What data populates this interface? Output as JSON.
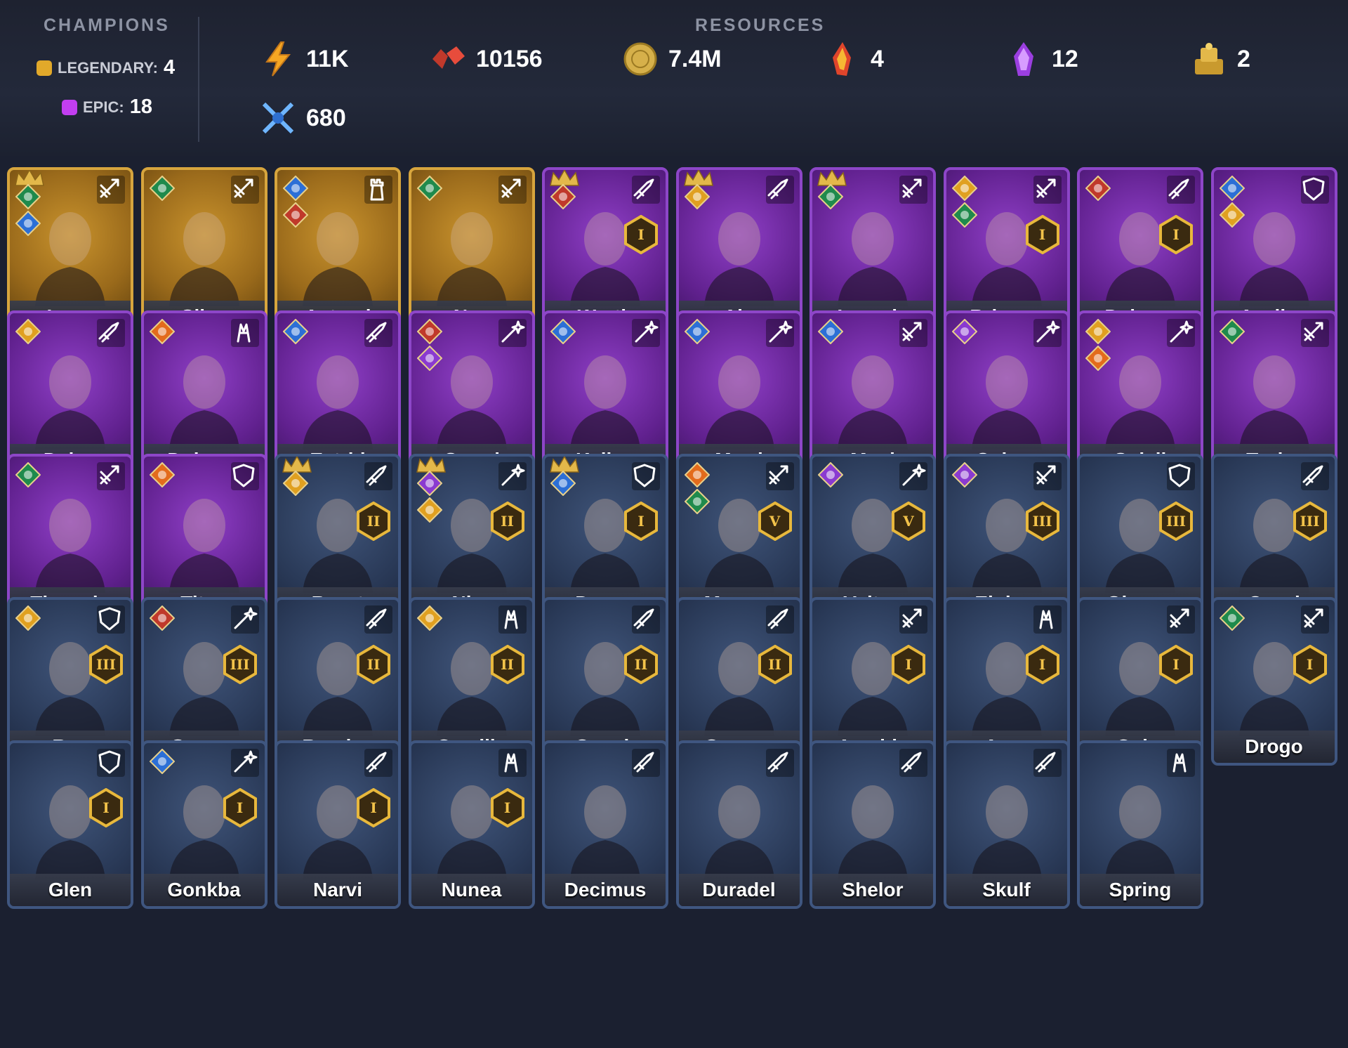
{
  "header": {
    "champions_title": "CHAMPIONS",
    "legendary_label": "LEGENDARY:",
    "legendary_count": "4",
    "epic_label": "EPIC:",
    "epic_count": "18",
    "resources_title": "RESOURCES",
    "resources": [
      {
        "icon": "energy-icon",
        "value": "11K"
      },
      {
        "icon": "rubies-icon",
        "value": "10156"
      },
      {
        "icon": "gold-icon",
        "value": "7.4M"
      },
      {
        "icon": "fire-shard-icon",
        "value": "4"
      },
      {
        "icon": "void-shard-icon",
        "value": "12"
      },
      {
        "icon": "gold-tokens-icon",
        "value": "2"
      },
      {
        "icon": "arena-swords-icon",
        "value": "680"
      }
    ]
  },
  "colors": {
    "legendary": "#d7a53d",
    "epic": "#8d46c8",
    "rare": "#3f5680",
    "rank_gold": "#f2c24a"
  },
  "champions": [
    {
      "name": "Iovar",
      "rarity": "legendary",
      "role": "attack-icon",
      "affinities": [
        "force",
        "magic"
      ],
      "crown": true,
      "rank": ""
    },
    {
      "name": "Silas",
      "rarity": "legendary",
      "role": "attack-icon",
      "affinities": [
        "force"
      ],
      "crown": false,
      "rank": ""
    },
    {
      "name": "Astrael",
      "rarity": "legendary",
      "role": "tower-icon",
      "affinities": [
        "magic",
        "spirit"
      ],
      "crown": false,
      "rank": ""
    },
    {
      "name": "Nyx",
      "rarity": "legendary",
      "role": "attack-icon",
      "affinities": [
        "force"
      ],
      "crown": false,
      "rank": ""
    },
    {
      "name": "Wrath",
      "rarity": "epic",
      "role": "sword-icon",
      "affinities": [
        "spirit"
      ],
      "crown": true,
      "rank": "I"
    },
    {
      "name": "Ain",
      "rarity": "epic",
      "role": "sword-icon",
      "affinities": [
        "void"
      ],
      "crown": true,
      "rank": ""
    },
    {
      "name": "Luneria",
      "rarity": "epic",
      "role": "attack-icon",
      "affinities": [
        "force"
      ],
      "crown": true,
      "rank": ""
    },
    {
      "name": "Brienne",
      "rarity": "epic",
      "role": "attack-icon",
      "affinities": [
        "void",
        "force"
      ],
      "crown": false,
      "rank": "I"
    },
    {
      "name": "Deimos",
      "rarity": "epic",
      "role": "sword-icon",
      "affinities": [
        "spirit"
      ],
      "crown": false,
      "rank": "I"
    },
    {
      "name": "Aveline",
      "rarity": "epic",
      "role": "shield-icon",
      "affinities": [
        "magic",
        "void"
      ],
      "crown": false,
      "rank": ""
    },
    {
      "name": "Dalyn",
      "rarity": "epic",
      "role": "sword-icon",
      "affinities": [
        "void"
      ],
      "crown": false,
      "rank": ""
    },
    {
      "name": "Dolores",
      "rarity": "epic",
      "role": "support-icon",
      "affinities": [
        "fire"
      ],
      "crown": false,
      "rank": ""
    },
    {
      "name": "Estrid",
      "rarity": "epic",
      "role": "sword-icon",
      "affinities": [
        "magic"
      ],
      "crown": false,
      "rank": ""
    },
    {
      "name": "Greed",
      "rarity": "epic",
      "role": "wand-icon",
      "affinities": [
        "spirit",
        "swirl"
      ],
      "crown": false,
      "rank": ""
    },
    {
      "name": "Kalina",
      "rarity": "epic",
      "role": "wand-icon",
      "affinities": [
        "magic"
      ],
      "crown": false,
      "rank": ""
    },
    {
      "name": "Marri",
      "rarity": "epic",
      "role": "wand-icon",
      "affinities": [
        "magic"
      ],
      "crown": false,
      "rank": ""
    },
    {
      "name": "Maul",
      "rarity": "epic",
      "role": "attack-icon",
      "affinities": [
        "magic"
      ],
      "crown": false,
      "rank": ""
    },
    {
      "name": "Osiren",
      "rarity": "epic",
      "role": "wand-icon",
      "affinities": [
        "swirl"
      ],
      "crown": false,
      "rank": ""
    },
    {
      "name": "Soleil",
      "rarity": "epic",
      "role": "wand-icon",
      "affinities": [
        "void",
        "fire"
      ],
      "crown": false,
      "rank": ""
    },
    {
      "name": "Tazira",
      "rarity": "epic",
      "role": "attack-icon",
      "affinities": [
        "force"
      ],
      "crown": false,
      "rank": ""
    },
    {
      "name": "Theowin",
      "rarity": "epic",
      "role": "attack-icon",
      "affinities": [
        "force"
      ],
      "crown": false,
      "rank": ""
    },
    {
      "name": "Titus",
      "rarity": "epic",
      "role": "shield-icon",
      "affinities": [
        "fire"
      ],
      "crown": false,
      "rank": ""
    },
    {
      "name": "Borut",
      "rarity": "rare",
      "role": "sword-icon",
      "affinities": [
        "void"
      ],
      "crown": true,
      "rank": "II"
    },
    {
      "name": "Niro",
      "rarity": "rare",
      "role": "wand-icon",
      "affinities": [
        "swirl",
        "void"
      ],
      "crown": true,
      "rank": "II"
    },
    {
      "name": "Dagna",
      "rarity": "rare",
      "role": "shield-icon",
      "affinities": [
        "magic"
      ],
      "crown": true,
      "rank": "I"
    },
    {
      "name": "Morene",
      "rarity": "rare",
      "role": "attack-icon",
      "affinities": [
        "fire",
        "force"
      ],
      "crown": false,
      "rank": "V"
    },
    {
      "name": "Voltus",
      "rarity": "rare",
      "role": "wand-icon",
      "affinities": [
        "swirl"
      ],
      "crown": false,
      "rank": "V"
    },
    {
      "name": "Elukas",
      "rarity": "rare",
      "role": "attack-icon",
      "affinities": [
        "swirl"
      ],
      "crown": false,
      "rank": "III"
    },
    {
      "name": "Ghorza",
      "rarity": "rare",
      "role": "shield-icon",
      "affinities": [],
      "crown": false,
      "rank": "III"
    },
    {
      "name": "Ogrul",
      "rarity": "rare",
      "role": "sword-icon",
      "affinities": [],
      "crown": false,
      "rank": "III"
    },
    {
      "name": "Rex",
      "rarity": "rare",
      "role": "shield-icon",
      "affinities": [
        "void"
      ],
      "crown": false,
      "rank": "III"
    },
    {
      "name": "Sorzus",
      "rarity": "rare",
      "role": "wand-icon",
      "affinities": [
        "spirit"
      ],
      "crown": false,
      "rank": "III"
    },
    {
      "name": "Barclay",
      "rarity": "rare",
      "role": "sword-icon",
      "affinities": [],
      "crown": false,
      "rank": "II"
    },
    {
      "name": "Camille",
      "rarity": "rare",
      "role": "support-icon",
      "affinities": [
        "void"
      ],
      "crown": false,
      "rank": "II"
    },
    {
      "name": "Gnash",
      "rarity": "rare",
      "role": "sword-icon",
      "affinities": [],
      "crown": false,
      "rank": "II"
    },
    {
      "name": "Gogran",
      "rarity": "rare",
      "role": "sword-icon",
      "affinities": [],
      "crown": false,
      "rank": "II"
    },
    {
      "name": "Amahle",
      "rarity": "rare",
      "role": "attack-icon",
      "affinities": [],
      "crown": false,
      "rank": "I"
    },
    {
      "name": "Aryn",
      "rarity": "rare",
      "role": "support-icon",
      "affinities": [],
      "crown": false,
      "rank": "I"
    },
    {
      "name": "Cuke",
      "rarity": "rare",
      "role": "attack-icon",
      "affinities": [],
      "crown": false,
      "rank": "I"
    },
    {
      "name": "Drogo",
      "rarity": "rare",
      "role": "attack-icon",
      "affinities": [
        "force"
      ],
      "crown": false,
      "rank": "I"
    },
    {
      "name": "Glen",
      "rarity": "rare",
      "role": "shield-icon",
      "affinities": [],
      "crown": false,
      "rank": "I"
    },
    {
      "name": "Gonkba",
      "rarity": "rare",
      "role": "wand-icon",
      "affinities": [
        "magic"
      ],
      "crown": false,
      "rank": "I"
    },
    {
      "name": "Narvi",
      "rarity": "rare",
      "role": "sword-icon",
      "affinities": [],
      "crown": false,
      "rank": "I"
    },
    {
      "name": "Nunea",
      "rarity": "rare",
      "role": "support-icon",
      "affinities": [],
      "crown": false,
      "rank": "I"
    },
    {
      "name": "Decimus",
      "rarity": "rare",
      "role": "sword-icon",
      "affinities": [],
      "crown": false,
      "rank": ""
    },
    {
      "name": "Duradel",
      "rarity": "rare",
      "role": "sword-icon",
      "affinities": [],
      "crown": false,
      "rank": ""
    },
    {
      "name": "Shelor",
      "rarity": "rare",
      "role": "sword-icon",
      "affinities": [],
      "crown": false,
      "rank": ""
    },
    {
      "name": "Skulf",
      "rarity": "rare",
      "role": "sword-icon",
      "affinities": [],
      "crown": false,
      "rank": ""
    },
    {
      "name": "Spring",
      "rarity": "rare",
      "role": "support-icon",
      "affinities": [],
      "crown": false,
      "rank": ""
    }
  ]
}
